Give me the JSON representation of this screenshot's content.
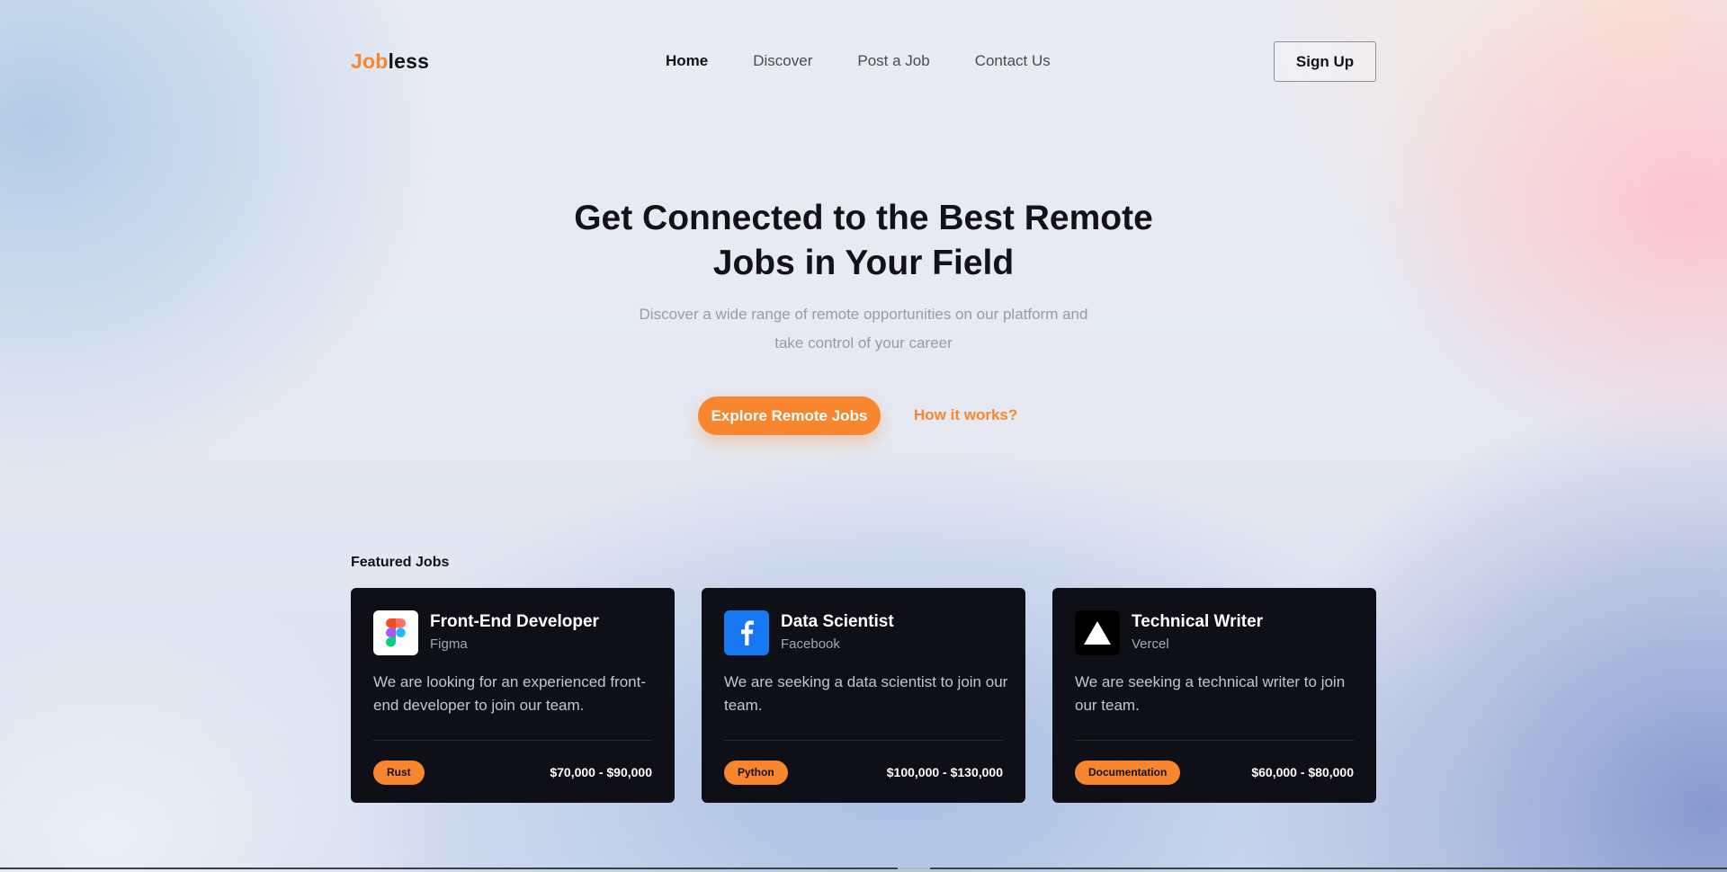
{
  "brand": {
    "part1": "Job",
    "part2": "less",
    "accent": "#f7862e"
  },
  "nav": {
    "items": [
      "Home",
      "Discover",
      "Post a Job",
      "Contact Us"
    ],
    "active": "Home"
  },
  "header": {
    "signup_label": "Sign Up"
  },
  "hero": {
    "title_line1": "Get Connected to the Best Remote",
    "title_line2": "Jobs in Your Field",
    "subtitle_line1": "Discover a wide range of remote opportunities on our platform and",
    "subtitle_line2": "take control of your career",
    "primary_cta": "Explore Remote Jobs",
    "secondary_cta": "How it works?"
  },
  "featured": {
    "heading": "Featured Jobs",
    "jobs": [
      {
        "title": "Front-End Developer",
        "company": "Figma",
        "icon": "figma-logo-icon",
        "description": "We are looking for an experienced front-end developer to join our team.",
        "tag": "Rust",
        "salary": "$70,000 - $90,000"
      },
      {
        "title": "Data Scientist",
        "company": "Facebook",
        "icon": "facebook-logo-icon",
        "description": "We are seeking a data scientist to join our team.",
        "tag": "Python",
        "salary": "$100,000 - $130,000"
      },
      {
        "title": "Technical Writer",
        "company": "Vercel",
        "icon": "vercel-logo-icon",
        "description": "We are seeking a technical writer to join our team.",
        "tag": "Documentation",
        "salary": "$60,000 - $80,000"
      }
    ]
  }
}
